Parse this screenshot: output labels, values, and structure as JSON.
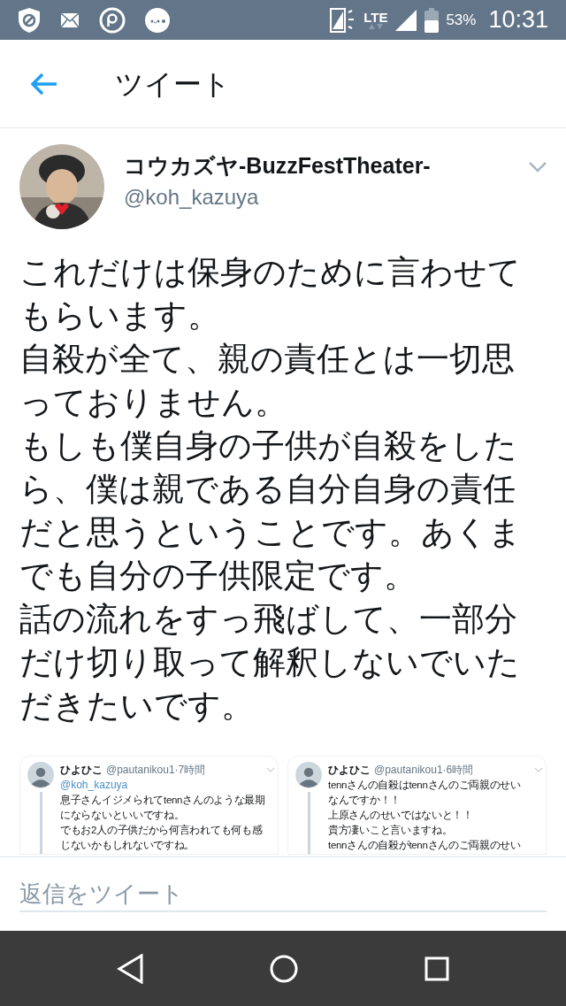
{
  "status_bar": {
    "network": "LTE",
    "battery": "53%",
    "time": "10:31"
  },
  "header": {
    "title": "ツイート"
  },
  "tweet": {
    "author": {
      "name": "コウカズヤ-BuzzFestTheater-",
      "handle": "@koh_kazuya"
    },
    "text_lines": [
      "これだけは保身のために言わせて",
      "もらいます。",
      "自殺が全て、親の責任とは一切思",
      "っておりません。",
      "もしも僕自身の子供が自殺をした",
      "ら、僕は親である自分自身の責任",
      "だと思うということです。あくま",
      "でも自分の子供限定です。",
      "話の流れをすっ飛ばして、一部分",
      "だけ切り取って解釈しないでいた",
      "だきたいです。"
    ],
    "media": [
      {
        "name": "ひよひこ",
        "handle": "@pautanikou1",
        "separator": "·",
        "time": "7時間",
        "lines": [
          {
            "kind": "mention",
            "text": "@koh_kazuya"
          },
          {
            "kind": "text",
            "text": "息子さんイジメられてtennさんのような最期"
          },
          {
            "kind": "text",
            "text": "にならないといいですね。"
          },
          {
            "kind": "text",
            "text": "でもお2人の子供だから何言われても何も感"
          },
          {
            "kind": "text",
            "text": "じないかもしれないですね。"
          }
        ]
      },
      {
        "name": "ひよひこ",
        "handle": "@pautanikou1",
        "separator": "·",
        "time": "6時間",
        "lines": [
          {
            "kind": "text",
            "text": "tennさんの自殺はtennさんのご両親のせい"
          },
          {
            "kind": "text",
            "text": "なんですか！！"
          },
          {
            "kind": "text",
            "text": "上原さんのせいではないと！！"
          },
          {
            "kind": "text",
            "text": "貴方凄いこと言いますね。"
          },
          {
            "kind": "text",
            "text": "tennさんの自殺がtennさんのご両親のせい"
          }
        ]
      }
    ]
  },
  "reply": {
    "placeholder": "返信をツイート"
  }
}
